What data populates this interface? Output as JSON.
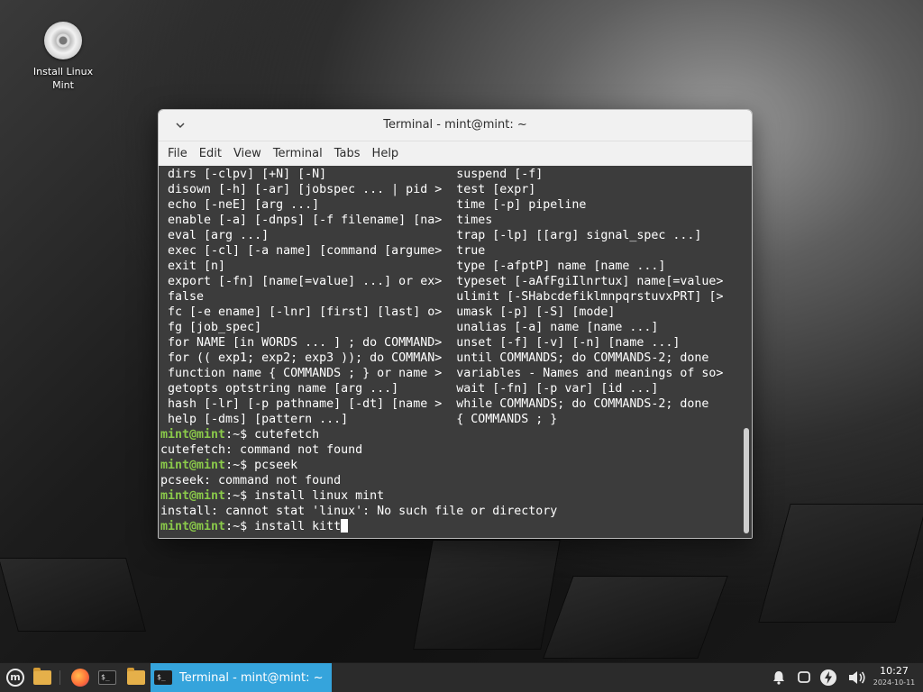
{
  "desktop": {
    "icons": [
      {
        "label_line1": "Install Linux",
        "label_line2": "Mint",
        "icon": "disc-icon"
      }
    ]
  },
  "window": {
    "title": "Terminal - mint@mint: ~",
    "menu": [
      "File",
      "Edit",
      "View",
      "Terminal",
      "Tabs",
      "Help"
    ],
    "controls": {
      "collapse": "chevron-down-icon",
      "minimize": "minimize-icon",
      "maximize": "maximize-icon",
      "close": "close-icon"
    }
  },
  "terminal": {
    "help_left": [
      " dirs [-clpv] [+N] [-N]",
      " disown [-h] [-ar] [jobspec ... | pid >",
      " echo [-neE] [arg ...]",
      " enable [-a] [-dnps] [-f filename] [na>",
      " eval [arg ...]",
      " exec [-cl] [-a name] [command [argume>",
      " exit [n]",
      " export [-fn] [name[=value] ...] or ex>",
      " false",
      " fc [-e ename] [-lnr] [first] [last] o>",
      " fg [job_spec]",
      " for NAME [in WORDS ... ] ; do COMMAND>",
      " for (( exp1; exp2; exp3 )); do COMMAN>",
      " function name { COMMANDS ; } or name >",
      " getopts optstring name [arg ...]",
      " hash [-lr] [-p pathname] [-dt] [name >",
      " help [-dms] [pattern ...]"
    ],
    "help_right": [
      "suspend [-f]",
      "test [expr]",
      "time [-p] pipeline",
      "times",
      "trap [-lp] [[arg] signal_spec ...]",
      "true",
      "type [-afptP] name [name ...]",
      "typeset [-aAfFgiIlnrtux] name[=value>",
      "ulimit [-SHabcdefiklmnpqrstuvxPRT] [>",
      "umask [-p] [-S] [mode]",
      "unalias [-a] name [name ...]",
      "unset [-f] [-v] [-n] [name ...]",
      "until COMMANDS; do COMMANDS-2; done",
      "variables - Names and meanings of so>",
      "wait [-fn] [-p var] [id ...]",
      "while COMMANDS; do COMMANDS-2; done",
      "{ COMMANDS ; }"
    ],
    "prompt_user": "mint@mint",
    "prompt_path": ":~$ ",
    "session": [
      {
        "type": "prompt",
        "cmd": "cutefetch"
      },
      {
        "type": "output",
        "text": "cutefetch: command not found"
      },
      {
        "type": "prompt",
        "cmd": "pcseek"
      },
      {
        "type": "output",
        "text": "pcseek: command not found"
      },
      {
        "type": "prompt",
        "cmd": "install linux mint"
      },
      {
        "type": "output",
        "text": "install: cannot stat 'linux': No such file or directory"
      },
      {
        "type": "prompt",
        "cmd": "install kitt",
        "cursor": true
      }
    ]
  },
  "taskbar": {
    "launchers": [
      "mint-menu-icon",
      "folder-icon",
      "firefox-icon",
      "terminal-icon",
      "files-icon"
    ],
    "active_task": "Terminal - mint@mint: ~",
    "tray": [
      "notifications-icon",
      "display-icon",
      "power-icon",
      "volume-icon"
    ],
    "clock_time": "10:27",
    "clock_date": "2024-10-11"
  },
  "colors": {
    "accent": "#35a4dc",
    "prompt": "#8ac94a",
    "terminal_bg": "#3c3c3c"
  }
}
